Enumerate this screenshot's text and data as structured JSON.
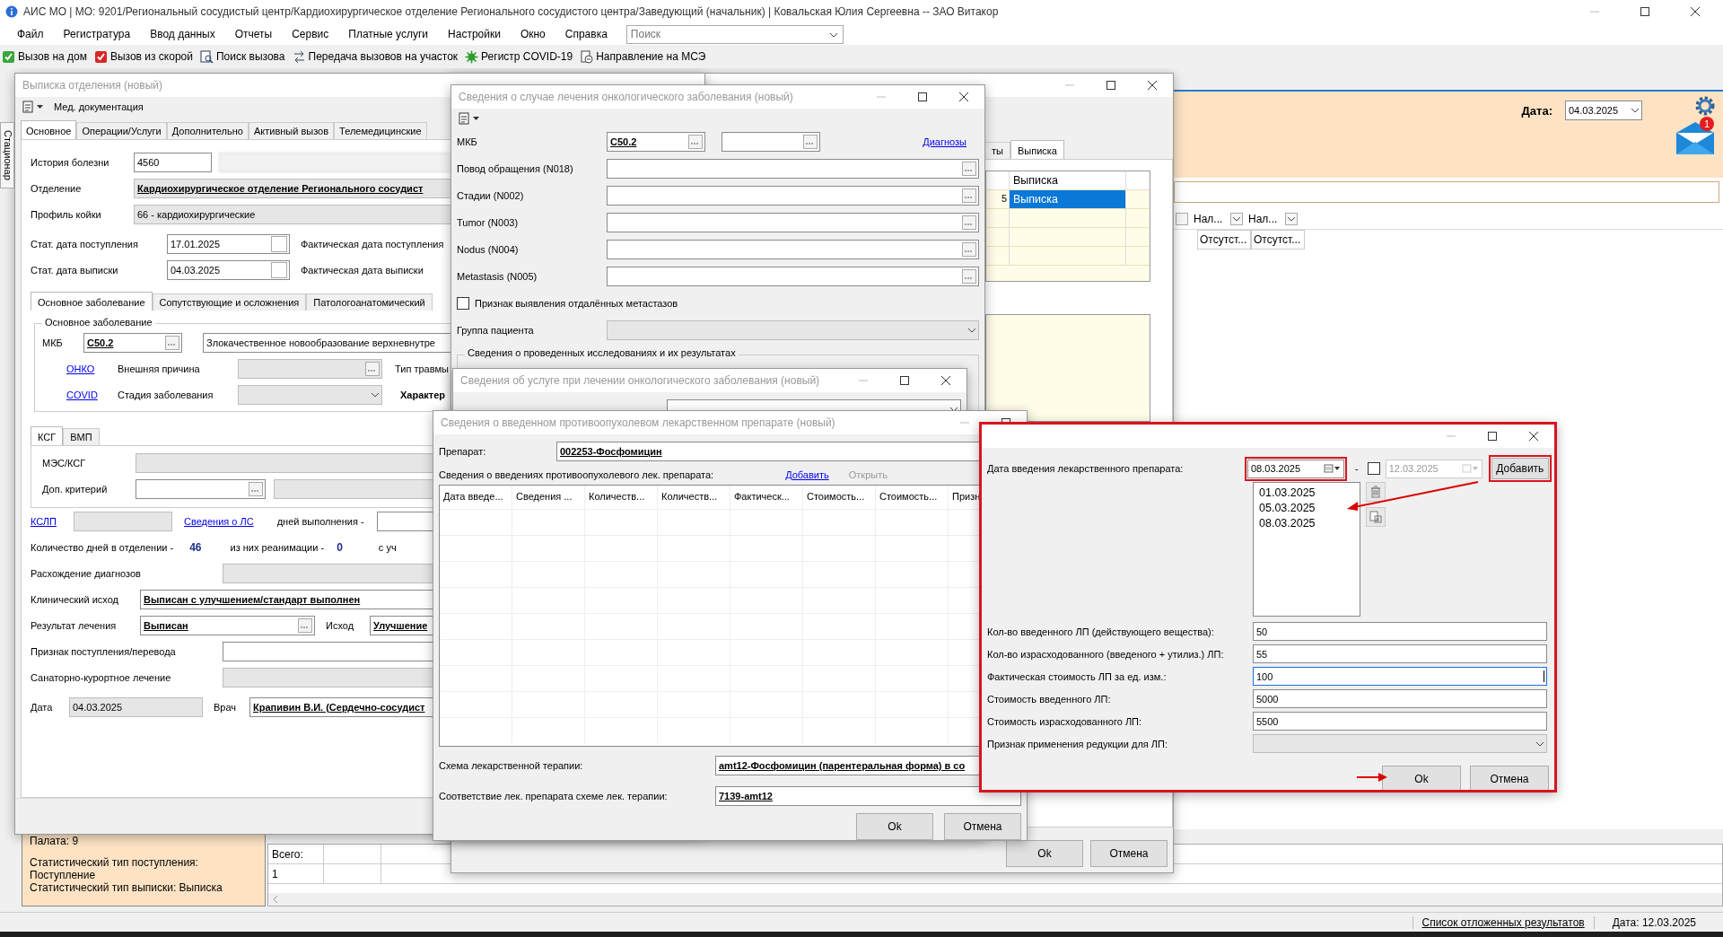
{
  "app": {
    "title": "АИС МО | МО: 9201/Региональный сосудистый центр/Кардиохирургическое отделение Регионального сосудистого центра/Заведующий (начальник) | Ковальская Юлия Сергеевна -- ЗАО Витакор",
    "menu": [
      "Файл",
      "Регистратура",
      "Ввод данных",
      "Отчеты",
      "Сервис",
      "Платные услуги",
      "Настройки",
      "Окно",
      "Справка"
    ],
    "search": {
      "placeholder": "Поиск"
    },
    "toolbar": [
      "Вызов на дом",
      "Вызов из скорой",
      "Поиск вызова",
      "Передача вызовов на участок",
      "Регистр COVID-19",
      "Направление на МСЭ"
    ],
    "side_tab": "Стационар",
    "header": {
      "date_label": "Дата:",
      "date_value": "04.03.2025",
      "mail_badge": "1"
    },
    "grid": {
      "columns": [
        "Нал...",
        "Нал..."
      ],
      "cells": [
        "Отсутст...",
        "Отсутст..."
      ]
    },
    "info_panel": [
      "Палата: 9",
      "Статистический тип поступления:",
      "Поступление",
      "Статистический тип выписки: Выписка"
    ],
    "totals": {
      "label": "Всего:",
      "value": "1"
    },
    "status_bar": {
      "link": "Список отложенных результатов",
      "date": "Дата: 12.03.2025"
    }
  },
  "back_window": {
    "tabs": [
      {
        "label": "ты",
        "selected": false
      },
      {
        "label": "Выписка",
        "selected": true
      }
    ],
    "grid_column": "Выписка",
    "grid_row": {
      "cells": [
        "5",
        "Выписка"
      ],
      "selected": true
    },
    "buttons": [
      "Ok",
      "Отмена"
    ]
  },
  "discharge_window": {
    "title": "Выписка отделения (новый)",
    "toolbar_label": "Мед. документация",
    "tabs": [
      {
        "label": "Основное",
        "selected": true
      },
      {
        "label": "Операции/Услуги",
        "selected": false
      },
      {
        "label": "Дополнительно",
        "selected": false
      },
      {
        "label": "Активный вызов",
        "selected": false
      },
      {
        "label": "Телемедицинские",
        "selected": false
      }
    ],
    "history": {
      "label": "История болезни",
      "value": "4560"
    },
    "department": {
      "label": "Отделение",
      "value": "Кардиохирургическое отделение Регионального сосудист"
    },
    "bed_profile": {
      "label": "Профиль койки",
      "value": "66 - кардиохирургические"
    },
    "admission": {
      "label": "Стат. дата поступления",
      "value": "17.01.2025",
      "actual_label": "Фактическая дата поступления"
    },
    "discharge": {
      "label": "Стат. дата выписки",
      "value": "04.03.2025",
      "actual_label": "Фактическая дата выписки"
    },
    "disease_tabs": [
      {
        "label": "Основное заболевание",
        "selected": true
      },
      {
        "label": "Сопутствующие и осложнения",
        "selected": false
      },
      {
        "label": "Патологоанатомический",
        "selected": false
      }
    ],
    "disease_group": {
      "title": "Основное заболевание",
      "mkb_label": "МКБ",
      "mkb_value": "C50.2",
      "mkb_description": "Злокачественное новообразование верхневнутре",
      "onko_link": "ОНКО",
      "external_cause_label": "Внешняя причина",
      "injury_type_label": "Тип травмы",
      "covid_link": "COVID",
      "stage_label": "Стадия заболевания",
      "character_label": "Характер"
    },
    "ksg_tabs": [
      {
        "label": "КСГ",
        "selected": true
      },
      {
        "label": "ВМП",
        "selected": false
      }
    ],
    "mes_label": "МЭС/КСГ",
    "extra_criterion_label": "Доп. критерий",
    "kslp_link": "КСЛП",
    "drugs_link": "Сведения о ЛС",
    "days_done_label": "дней выполнения -",
    "days": {
      "label": "Количество дней в отделении -",
      "value": "46",
      "icu_label": "из них реанимации -",
      "icu_value": "0",
      "rest": "с уч"
    },
    "diagnosis_mismatch_label": "Расхождение диагнозов",
    "clinical_outcome": {
      "label": "Клинический исход",
      "value": "Выписан с улучшением/стандарт выполнен"
    },
    "result": {
      "label": "Результат лечения",
      "value": "Выписан",
      "outcome_label": "Исход",
      "outcome_value": "Улучшение"
    },
    "admission_sign_label": "Признак поступления/перевода",
    "sanatorium_label": "Санаторно-курортное лечение",
    "signature": {
      "date_label": "Дата",
      "date_value": "04.03.2025",
      "doctor_label": "Врач",
      "doctor_value": "Крапивин В.И. (Сердечно-сосудист"
    }
  },
  "oncology_window": {
    "title": "Сведения о случае лечения онкологического заболевания (новый)",
    "mkb_label": "МКБ",
    "mkb_value": "C50.2",
    "diagnoses_link": "Диагнозы",
    "fields": [
      {
        "label": "Повод обращения (N018)"
      },
      {
        "label": "Стадии (N002)"
      },
      {
        "label": "Tumor (N003)"
      },
      {
        "label": "Nodus (N004)"
      },
      {
        "label": "Metastasis (N005)"
      }
    ],
    "metastases": {
      "label": "Признак выявления отдалённых метастазов",
      "checked": false
    },
    "patient_group_label": "Группа пациента",
    "research_group": "Сведения о проведенных исследованиях и их результатах"
  },
  "service_window": {
    "title": "Сведения об услуге при лечении онкологического заболевания (новый)"
  },
  "drug_window": {
    "title": "Сведения о введенном противоопухолевом лекарственном препарате (новый)",
    "drug_label": "Препарат:",
    "drug_value": "002253-Фосфомицин",
    "list_label": "Сведения о введениях противоопухолевого лек. препарата:",
    "actions": [
      {
        "label": "Добавить",
        "disabled": false
      },
      {
        "label": "Открыть",
        "disabled": true
      }
    ],
    "columns": [
      "Дата введе...",
      "Сведения ...",
      "Количеств...",
      "Количеств...",
      "Фактическ...",
      "Стоимость...",
      "Стоимость...",
      "Призн"
    ],
    "scheme": {
      "label": "Схема лекарственной терапии:",
      "value": "amt12-Фосфомицин (парентеральная форма) в со"
    },
    "match": {
      "label": "Соответствие лек. препарата схеме лек. терапии:",
      "value": "7139-amt12"
    },
    "buttons": [
      "Ok",
      "Отмена"
    ]
  },
  "dose_dialog": {
    "highlighted": true,
    "date_label": "Дата введения лекарственного препарата:",
    "date": {
      "value": "08.03.2025",
      "highlighted": true
    },
    "range_separator": "-",
    "range_end": {
      "checked": false,
      "value": "12.03.2025"
    },
    "add_button": {
      "label": "Добавить",
      "highlighted": true
    },
    "dates": [
      "01.03.2025",
      "05.03.2025",
      "08.03.2025"
    ],
    "fields": [
      {
        "label": "Кол-во введенного ЛП (действующего вещества):",
        "value": "50",
        "focused": false
      },
      {
        "label": "Кол-во израсходованного (введеного + утилиз.) ЛП:",
        "value": "55",
        "focused": false
      },
      {
        "label": "Фактическая стоимость ЛП за ед. изм.:",
        "value": "100",
        "focused": true
      },
      {
        "label": "Стоимость введенного ЛП:",
        "value": "5000",
        "focused": false
      },
      {
        "label": "Стоимость израсходованного ЛП:",
        "value": "5500",
        "focused": false
      }
    ],
    "reduction_label": "Признак применения редукции для ЛП:",
    "buttons": [
      "Ok",
      "Отмена"
    ]
  }
}
